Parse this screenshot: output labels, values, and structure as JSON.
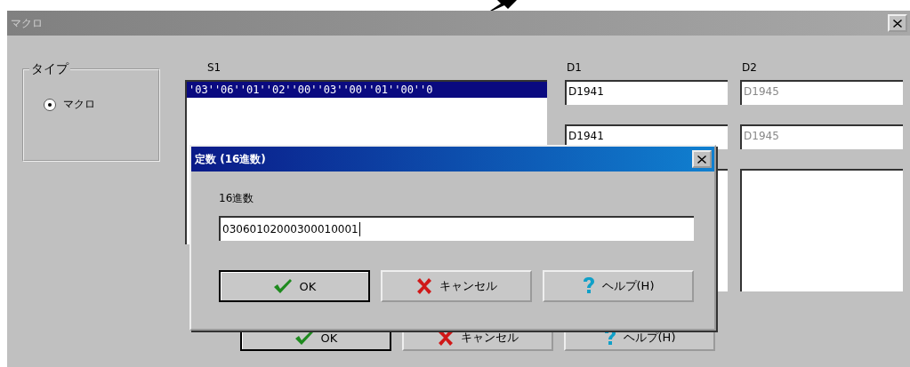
{
  "main_window": {
    "title": "マクロ",
    "active": false,
    "type_group": {
      "label": "タイプ",
      "options": [
        {
          "label": "マクロ",
          "selected": true
        }
      ]
    },
    "s1": {
      "label": "S1",
      "items": [
        {
          "text": "'03''06''01''02''00''03''00''01''00''0",
          "selected": true
        }
      ]
    },
    "d1": {
      "label": "D1",
      "fields": [
        {
          "value": "D1941",
          "disabled": false
        },
        {
          "value": "D1941",
          "disabled": false
        }
      ]
    },
    "d2": {
      "label": "D2",
      "fields": [
        {
          "value": "D1945",
          "disabled": true
        },
        {
          "value": "D1945",
          "disabled": true
        }
      ]
    },
    "buttons": [
      {
        "kind": "ok",
        "label": "OK",
        "default": true
      },
      {
        "kind": "cancel",
        "label": "キャンセル",
        "default": false
      },
      {
        "kind": "help",
        "label": "ヘルプ(H)",
        "default": false
      }
    ]
  },
  "dialog": {
    "title": "定数 (16進数)",
    "active": true,
    "field_label": "16進数",
    "value": "03060102000300010001",
    "buttons": [
      {
        "kind": "ok",
        "label": "OK",
        "default": true
      },
      {
        "kind": "cancel",
        "label": "キャンセル",
        "default": false
      },
      {
        "kind": "help",
        "label": "ヘルプ(H)",
        "default": false
      }
    ]
  }
}
